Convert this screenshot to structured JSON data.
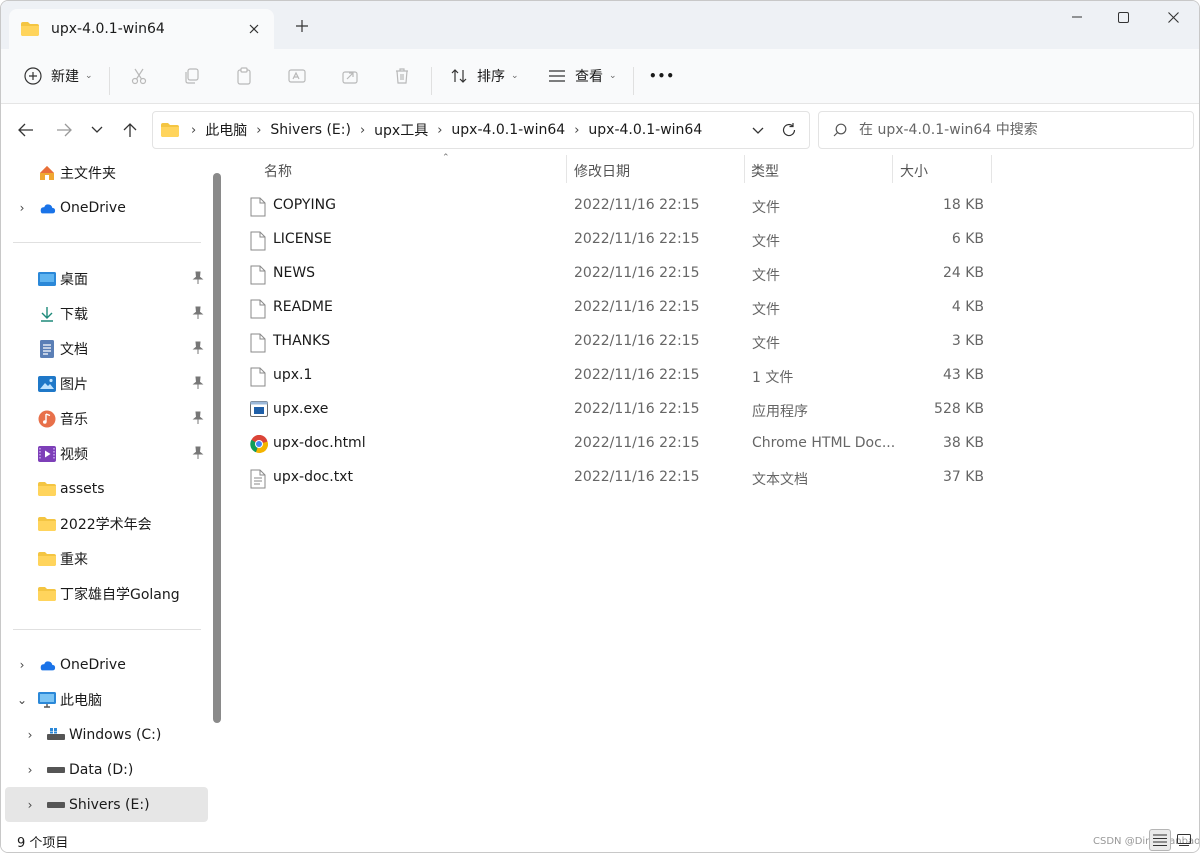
{
  "tab": {
    "title": "upx-4.0.1-win64"
  },
  "toolbar": {
    "new_label": "新建",
    "sort_label": "排序",
    "view_label": "查看",
    "more_label": "•••"
  },
  "address": {
    "crumbs": [
      "此电脑",
      "Shivers (E:)",
      "upx工具",
      "upx-4.0.1-win64",
      "upx-4.0.1-win64"
    ]
  },
  "search": {
    "placeholder": "在 upx-4.0.1-win64 中搜索"
  },
  "sidebar": {
    "home": "主文件夹",
    "onedrive_top": "OneDrive",
    "quick": [
      "桌面",
      "下载",
      "文档",
      "图片",
      "音乐",
      "视频",
      "assets",
      "2022学术年会",
      "重来",
      "丁家雄自学Golang"
    ],
    "onedrive_bottom": "OneDrive",
    "this_pc": "此电脑",
    "drives": [
      "Windows (C:)",
      "Data (D:)",
      "Shivers (E:)"
    ]
  },
  "columns": {
    "name": "名称",
    "date": "修改日期",
    "type": "类型",
    "size": "大小"
  },
  "files": [
    {
      "name": "COPYING",
      "date": "2022/11/16 22:15",
      "type": "文件",
      "size": "18 KB",
      "icon": "file-icon"
    },
    {
      "name": "LICENSE",
      "date": "2022/11/16 22:15",
      "type": "文件",
      "size": "6 KB",
      "icon": "file-icon"
    },
    {
      "name": "NEWS",
      "date": "2022/11/16 22:15",
      "type": "文件",
      "size": "24 KB",
      "icon": "file-icon"
    },
    {
      "name": "README",
      "date": "2022/11/16 22:15",
      "type": "文件",
      "size": "4 KB",
      "icon": "file-icon"
    },
    {
      "name": "THANKS",
      "date": "2022/11/16 22:15",
      "type": "文件",
      "size": "3 KB",
      "icon": "file-icon"
    },
    {
      "name": "upx.1",
      "date": "2022/11/16 22:15",
      "type": "1 文件",
      "size": "43 KB",
      "icon": "file-icon"
    },
    {
      "name": "upx.exe",
      "date": "2022/11/16 22:15",
      "type": "应用程序",
      "size": "528 KB",
      "icon": "exe-icon"
    },
    {
      "name": "upx-doc.html",
      "date": "2022/11/16 22:15",
      "type": "Chrome HTML Doc...",
      "size": "38 KB",
      "icon": "chrome-icon"
    },
    {
      "name": "upx-doc.txt",
      "date": "2022/11/16 22:15",
      "type": "文本文档",
      "size": "37 KB",
      "icon": "text-file-icon"
    }
  ],
  "status": {
    "count": "9 个项目"
  },
  "watermark": "CSDN @DingYuanbao"
}
